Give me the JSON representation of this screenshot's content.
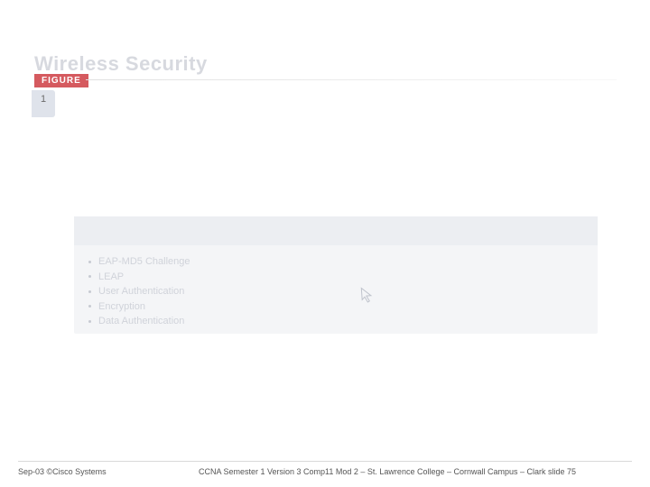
{
  "title": "Wireless Security",
  "figure_label": "FIGURE",
  "tab": {
    "label": "1"
  },
  "bullets": [
    "EAP-MD5 Challenge",
    "LEAP",
    "User Authentication",
    "Encryption",
    "Data Authentication"
  ],
  "footer": {
    "left": "Sep-03 ©Cisco Systems",
    "center": "CCNA Semester 1 Version 3 Comp11 Mod 2 – St. Lawrence College – Cornwall Campus – Clark slide 75"
  }
}
